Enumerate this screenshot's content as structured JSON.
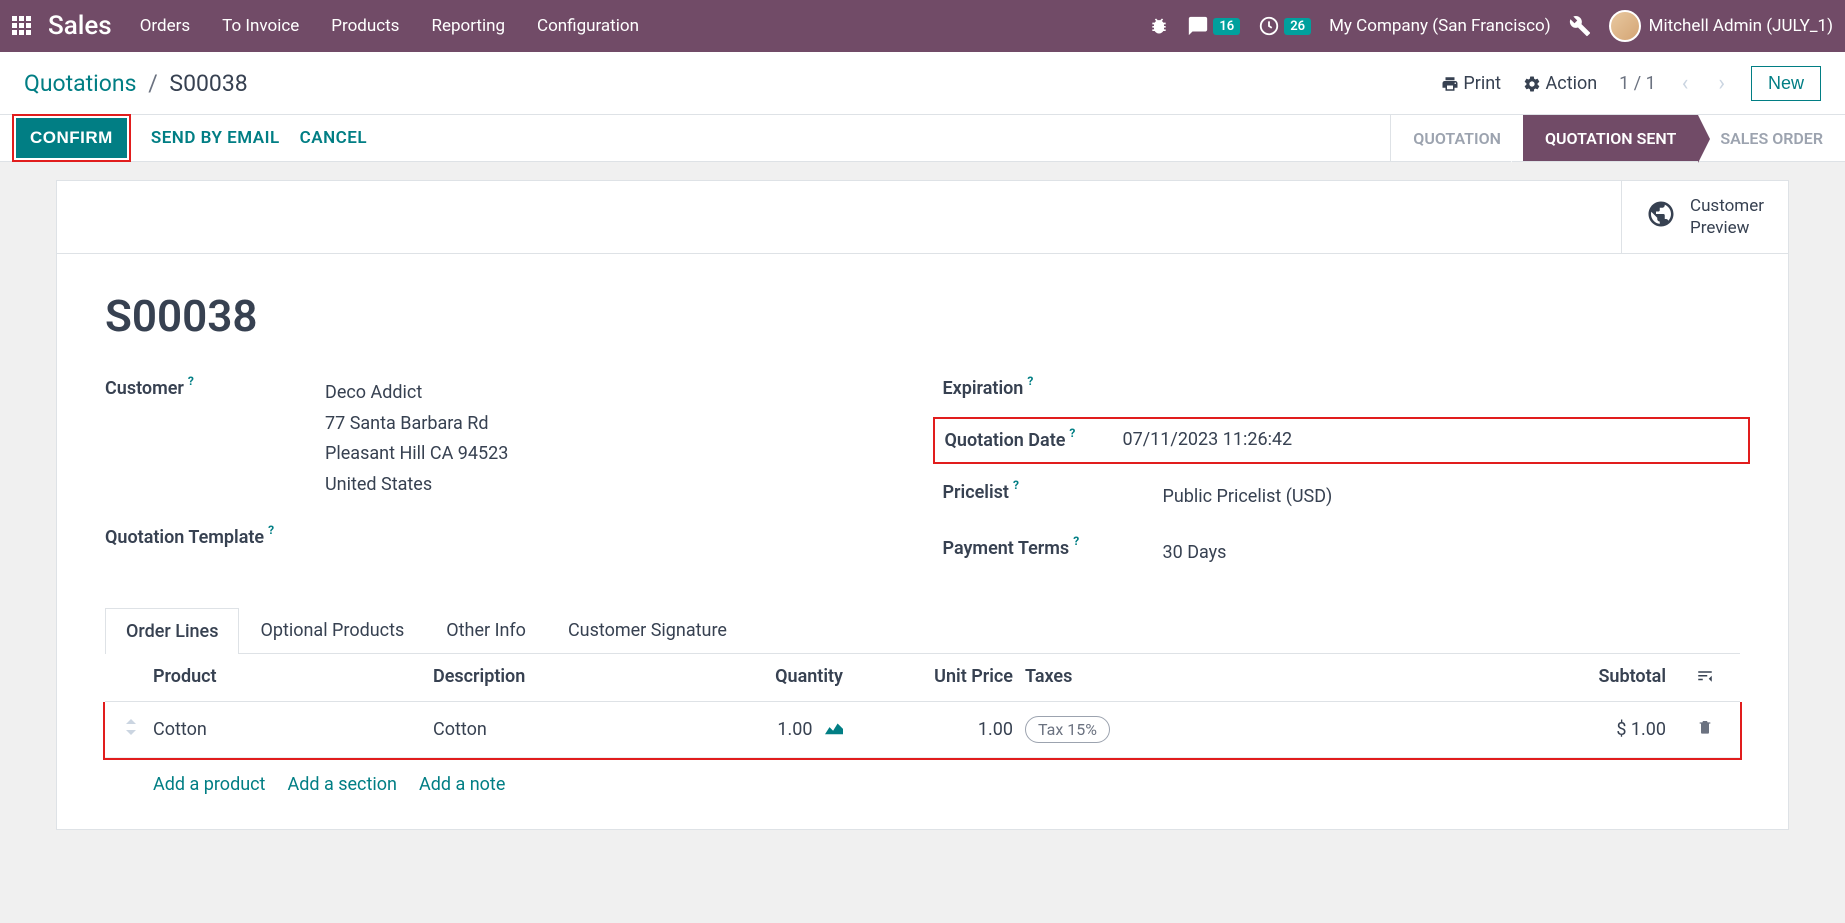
{
  "topnav": {
    "brand": "Sales",
    "menu": [
      "Orders",
      "To Invoice",
      "Products",
      "Reporting",
      "Configuration"
    ],
    "messages_badge": "16",
    "activities_badge": "26",
    "company": "My Company (San Francisco)",
    "user": "Mitchell Admin (JULY_1)"
  },
  "breadcrumb": {
    "root": "Quotations",
    "current": "S00038",
    "print": "Print",
    "action": "Action",
    "pager": "1 / 1",
    "new": "New"
  },
  "statusbar": {
    "confirm": "CONFIRM",
    "send_email": "SEND BY EMAIL",
    "cancel": "CANCEL",
    "stages": [
      "QUOTATION",
      "QUOTATION SENT",
      "SALES ORDER"
    ],
    "active_stage": 1
  },
  "sheet": {
    "customer_preview": "Customer\nPreview",
    "title": "S00038",
    "labels": {
      "customer": "Customer",
      "quotation_template": "Quotation Template",
      "expiration": "Expiration",
      "quotation_date": "Quotation Date",
      "pricelist": "Pricelist",
      "payment_terms": "Payment Terms"
    },
    "values": {
      "customer_name": "Deco Addict",
      "customer_addr1": "77 Santa Barbara Rd",
      "customer_addr2": "Pleasant Hill CA 94523",
      "customer_country": "United States",
      "quotation_date": "07/11/2023 11:26:42",
      "pricelist": "Public Pricelist (USD)",
      "payment_terms": "30 Days"
    }
  },
  "tabs": [
    "Order Lines",
    "Optional Products",
    "Other Info",
    "Customer Signature"
  ],
  "lines": {
    "headers": {
      "product": "Product",
      "description": "Description",
      "quantity": "Quantity",
      "unit_price": "Unit Price",
      "taxes": "Taxes",
      "subtotal": "Subtotal"
    },
    "rows": [
      {
        "product": "Cotton",
        "description": "Cotton",
        "quantity": "1.00",
        "unit_price": "1.00",
        "tax": "Tax 15%",
        "subtotal": "$ 1.00"
      }
    ],
    "add_product": "Add a product",
    "add_section": "Add a section",
    "add_note": "Add a note"
  }
}
